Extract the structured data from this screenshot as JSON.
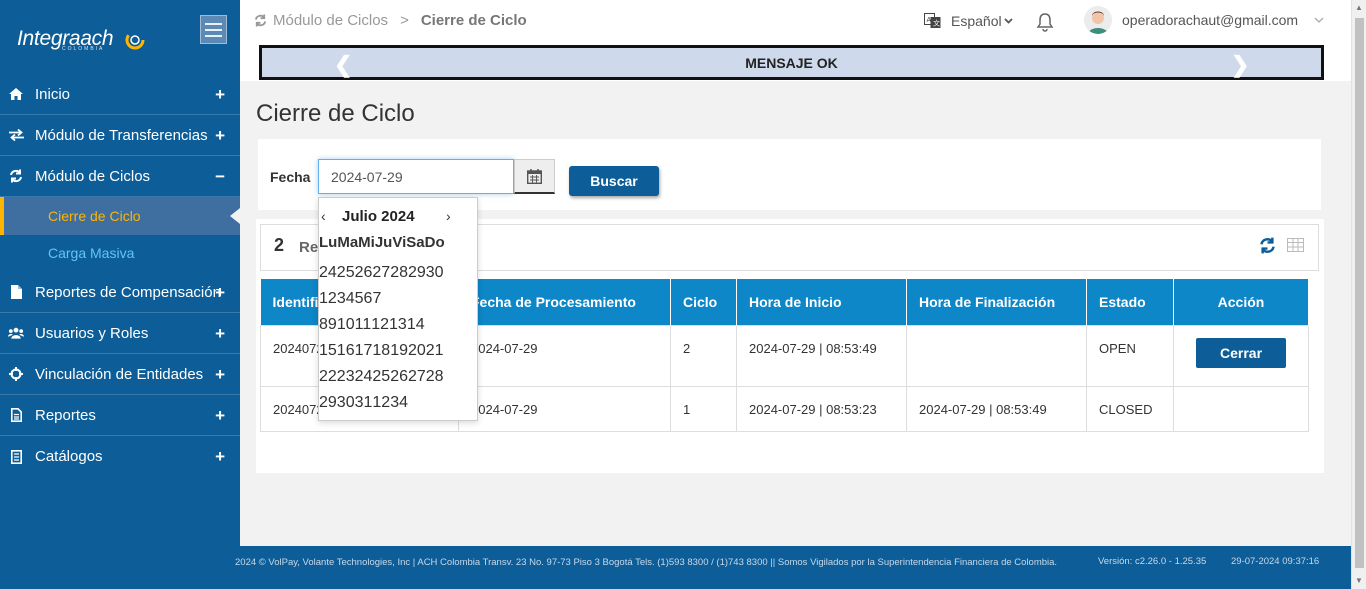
{
  "brand": {
    "logo_text": "Integraach",
    "logo_sub": "COLOMBIA"
  },
  "sidebar": {
    "items": [
      {
        "label": "Inicio",
        "icon": "home-icon",
        "toggle": "+"
      },
      {
        "label": "Módulo de Transferencias",
        "icon": "exchange-icon",
        "toggle": "+"
      },
      {
        "label": "Módulo de Ciclos",
        "icon": "refresh-icon",
        "toggle": "−"
      },
      {
        "label": "Reportes de Compensación",
        "icon": "file-icon",
        "toggle": "+"
      },
      {
        "label": "Usuarios y Roles",
        "icon": "users-icon",
        "toggle": "+"
      },
      {
        "label": "Vinculación de Entidades",
        "icon": "crosshairs-icon",
        "toggle": "+"
      },
      {
        "label": "Reportes",
        "icon": "file-text-icon",
        "toggle": "+"
      },
      {
        "label": "Catálogos",
        "icon": "list-icon",
        "toggle": "+"
      }
    ],
    "subitems": [
      {
        "label": "Cierre de Ciclo",
        "active": true
      },
      {
        "label": "Carga Masiva",
        "active": false
      }
    ]
  },
  "header": {
    "breadcrumb_parent": "Módulo de Ciclos",
    "breadcrumb_sep": ">",
    "breadcrumb_current": "Cierre de Ciclo",
    "language": "Español",
    "user_email": "operadorachaut@gmail.com",
    "banner": "MENSAJE OK"
  },
  "page": {
    "title": "Cierre de Ciclo"
  },
  "search": {
    "label": "Fecha",
    "date_value": "2024-07-29",
    "button": "Buscar"
  },
  "results": {
    "count": "2",
    "label_partial": "Re",
    "columns": [
      "Identifi",
      "Fecha de Procesamiento",
      "Ciclo",
      "Hora de Inicio",
      "Hora de Finalización",
      "Estado",
      "Acción"
    ],
    "rows": [
      {
        "id": "2024072",
        "fecha": "2024-07-29",
        "ciclo": "2",
        "inicio": "2024-07-29 | 08:53:49",
        "fin": "",
        "estado": "OPEN",
        "accion": "Cerrar"
      },
      {
        "id": "2024072",
        "fecha": "2024-07-29",
        "ciclo": "1",
        "inicio": "2024-07-29 | 08:53:23",
        "fin": "2024-07-29 | 08:53:49",
        "estado": "CLOSED",
        "accion": ""
      }
    ]
  },
  "datepicker": {
    "month_label": "Julio 2024",
    "prev": "‹",
    "next": "›",
    "weekdays": [
      "Lu",
      "Ma",
      "Mi",
      "Ju",
      "Vi",
      "Sa",
      "Do"
    ],
    "weeks": [
      [
        "24",
        "25",
        "26",
        "27",
        "28",
        "29",
        "30"
      ],
      [
        "1",
        "2",
        "3",
        "4",
        "5",
        "6",
        "7"
      ],
      [
        "8",
        "9",
        "10",
        "11",
        "12",
        "13",
        "14"
      ],
      [
        "15",
        "16",
        "17",
        "18",
        "19",
        "20",
        "21"
      ],
      [
        "22",
        "23",
        "24",
        "25",
        "26",
        "27",
        "28"
      ],
      [
        "29",
        "30",
        "31",
        "1",
        "2",
        "3",
        "4"
      ]
    ]
  },
  "footer": {
    "copyright": "2024 © VolPay, Volante Technologies, Inc | ACH Colombia Transv. 23 No. 97-73 Piso 3 Bogotá Tels. (1)593 8300 / (1)743 8300 || Somos Vigilados por la Superintendencia Financiera de Colombia.",
    "version": "Versión: c2.26.0 - 1.25.35",
    "timestamp": "29-07-2024 09:37:16"
  },
  "colors": {
    "sidebar": "#0d5d98",
    "accent": "#ffb400",
    "table_header": "#0d87c8",
    "button": "#0d5d98"
  }
}
